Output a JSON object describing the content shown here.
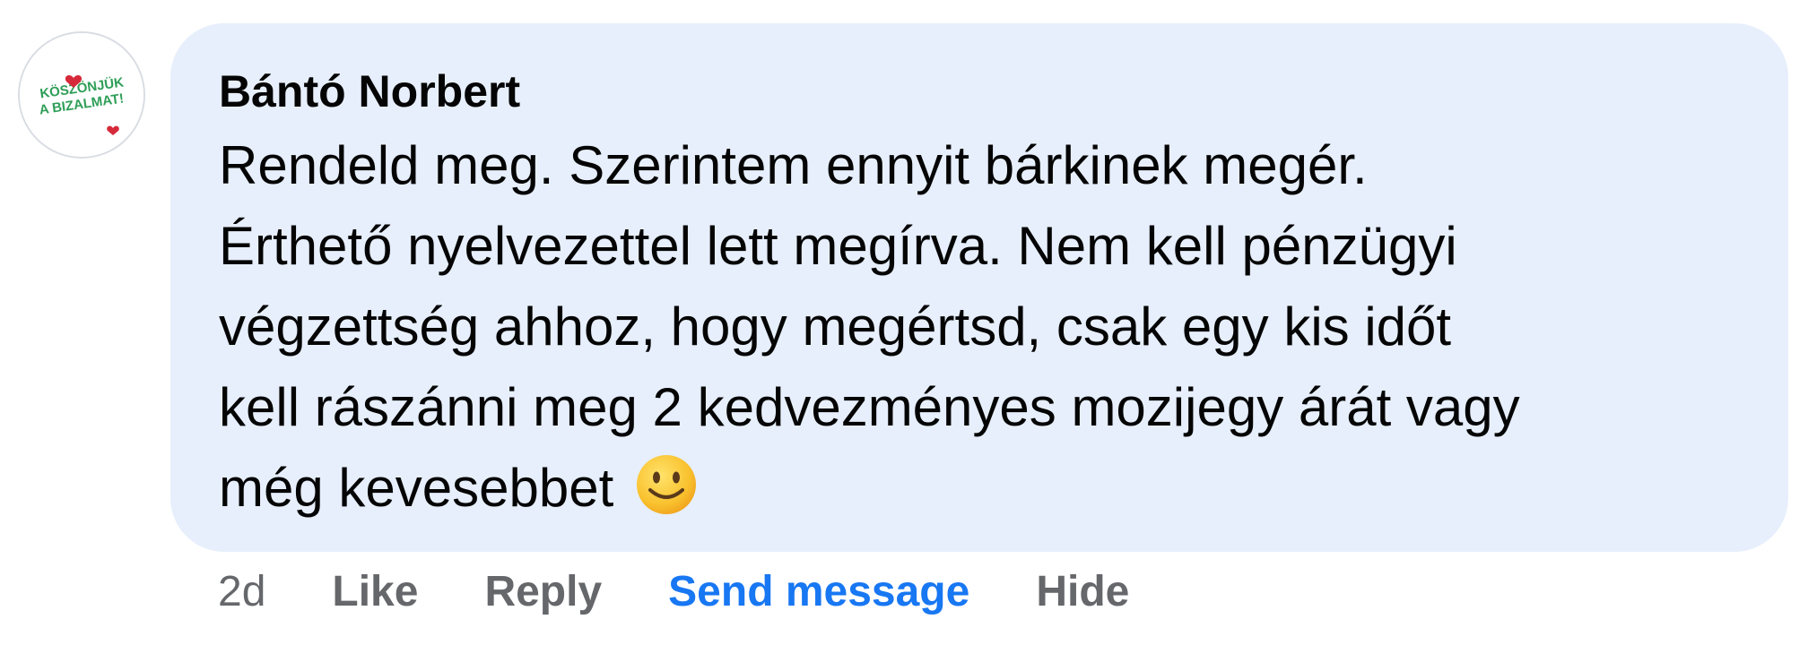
{
  "comment": {
    "author": "Bántó Norbert",
    "lines": [
      "Rendeld meg. Szerintem ennyit bárkinek megér.",
      "Érthető nyelvezettel lett megírva. Nem kell pénzügyi",
      "végzettség ahhoz, hogy megértsd, csak egy kis időt",
      "kell rászánni meg 2 kedvezményes mozijegy árát vagy",
      "még kevesebbet"
    ],
    "emoji_icon": "slightly-smiling-face-icon",
    "avatar_text_top": "KÖSZÖNJÜK",
    "avatar_text_bottom": "A BIZALMAT!"
  },
  "actions": {
    "timestamp": "2d",
    "like_label": "Like",
    "reply_label": "Reply",
    "send_message_label": "Send message",
    "hide_label": "Hide"
  },
  "colors": {
    "bubble_bg": "#e7effc",
    "secondary_text": "#65676b",
    "link_blue": "#1877f2",
    "avatar_green": "#2e9e57",
    "avatar_red": "#d62a3a"
  }
}
